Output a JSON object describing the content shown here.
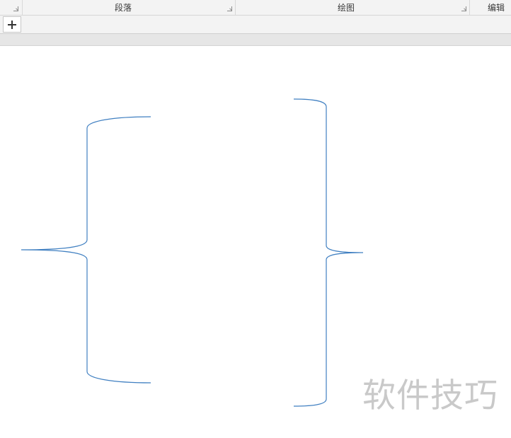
{
  "ribbon": {
    "groups": [
      {
        "label": "段落"
      },
      {
        "label": "绘图"
      },
      {
        "label": "编辑"
      }
    ]
  },
  "quick_bar": {
    "add_icon": "plus-icon"
  },
  "canvas": {
    "shapes": [
      {
        "type": "left-brace",
        "color": "#3f7fc1"
      },
      {
        "type": "right-brace",
        "color": "#3f7fc1"
      }
    ]
  },
  "watermark": {
    "text": "软件技巧"
  }
}
